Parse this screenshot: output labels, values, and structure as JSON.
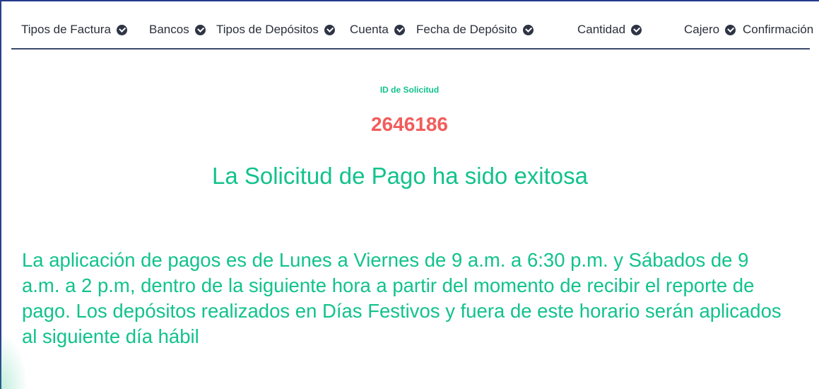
{
  "steps": [
    {
      "label": "Tipos de Factura",
      "icon": "check-circle-icon"
    },
    {
      "label": "Bancos",
      "icon": "check-circle-icon"
    },
    {
      "label": "Tipos de Depósitos",
      "icon": "check-circle-icon"
    },
    {
      "label": "Cuenta",
      "icon": "check-circle-icon"
    },
    {
      "label": "Fecha de Depósito",
      "icon": "check-circle-icon"
    },
    {
      "label": "Cantidad",
      "icon": "check-circle-icon"
    },
    {
      "label": "Cajero",
      "icon": "check-circle-icon"
    },
    {
      "label": "Confirmación"
    }
  ],
  "request": {
    "id_label": "ID de Solicitud",
    "id_value": "2646186"
  },
  "success_message": "La Solicitud de Pago ha sido exitosa",
  "schedule_note": "La aplicación de pagos es de Lunes a Viernes de 9 a.m. a 6:30 p.m. y Sábados de 9 a.m. a 2 p.m, dentro de la siguiente hora a partir del momento de recibir el reporte de pago. Los depósitos realizados en Días Festivos y fuera de este horario serán aplicados al siguiente día hábil",
  "colors": {
    "accent_green": "#12c28c",
    "id_red": "#f25c5c",
    "frame_blue": "#243a8c"
  }
}
